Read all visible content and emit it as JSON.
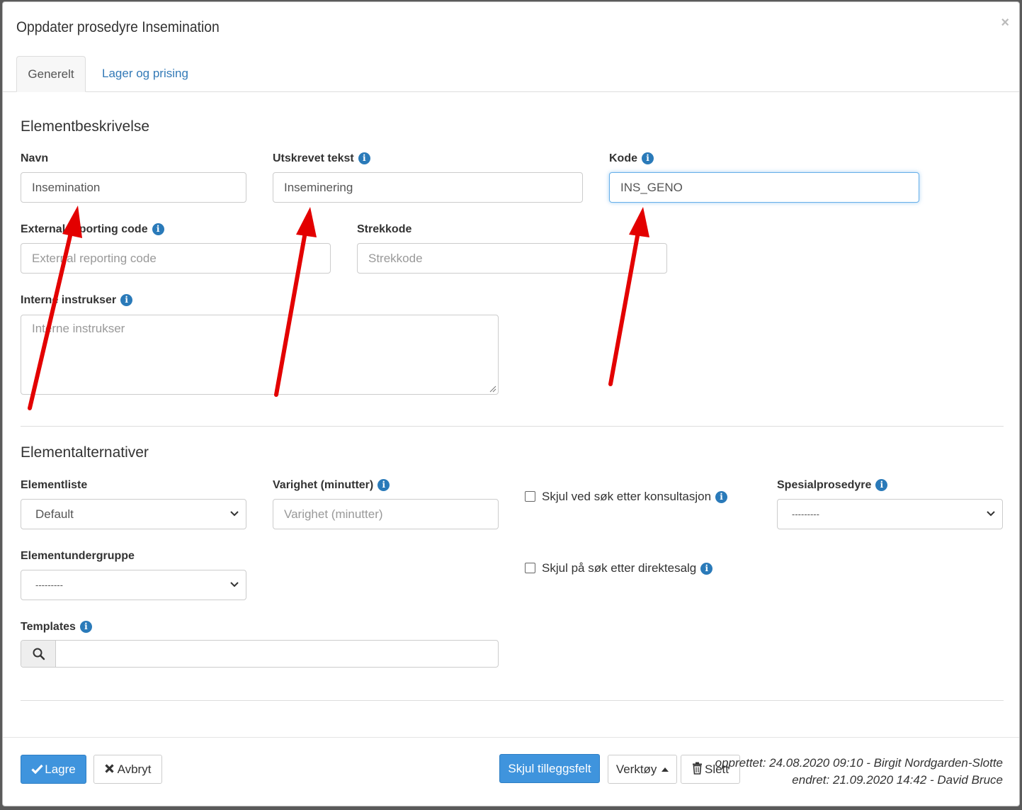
{
  "modal": {
    "title": "Oppdater prosedyre Insemination",
    "close": "×"
  },
  "tabs": [
    {
      "label": "Generelt",
      "active": true
    },
    {
      "label": "Lager og prising",
      "active": false
    }
  ],
  "sections": {
    "description_title": "Elementbeskrivelse",
    "alternatives_title": "Elementalternativer"
  },
  "fields": {
    "navn": {
      "label": "Navn",
      "value": "Insemination"
    },
    "utskrevet_tekst": {
      "label": "Utskrevet tekst",
      "value": "Inseminering"
    },
    "kode": {
      "label": "Kode",
      "value": "INS_GENO"
    },
    "external_code": {
      "label": "External reporting code",
      "placeholder": "External reporting code"
    },
    "strekkode": {
      "label": "Strekkode",
      "placeholder": "Strekkode"
    },
    "interne_instrukser": {
      "label": "Interne instrukser",
      "placeholder": "Interne instrukser"
    },
    "elementliste": {
      "label": "Elementliste",
      "value": "Default"
    },
    "varighet": {
      "label": "Varighet (minutter)",
      "placeholder": "Varighet (minutter)"
    },
    "skjul_konsultasjon": {
      "label": "Skjul ved søk etter konsultasjon",
      "checked": false
    },
    "spesialprosedyre": {
      "label": "Spesialprosedyre",
      "value": "---------"
    },
    "elementundergruppe": {
      "label": "Elementundergruppe",
      "value": "---------"
    },
    "skjul_direktesalg": {
      "label": "Skjul på søk etter direktesalg",
      "checked": false
    },
    "templates": {
      "label": "Templates",
      "value": ""
    }
  },
  "footer": {
    "save": "Lagre",
    "cancel": "Avbryt",
    "toggle_extra": "Skjul tilleggsfelt",
    "tools": "Verktøy",
    "delete": "Slett",
    "created": "opprettet: 24.08.2020 09:10 - Birgit Nordgarden-Slotte",
    "changed": "endret: 21.09.2020 14:42 - David Bruce"
  },
  "colors": {
    "primary": "#3f94dd",
    "link": "#337ab7",
    "info_icon": "#2a7ab9",
    "annotation_arrow": "#e30000"
  },
  "icons": {
    "info": "info-icon",
    "search": "search-icon",
    "check": "check-icon",
    "times": "times-icon",
    "trash": "trash-icon",
    "caret": "caret-up-icon",
    "chevron": "chevron-down-icon"
  }
}
